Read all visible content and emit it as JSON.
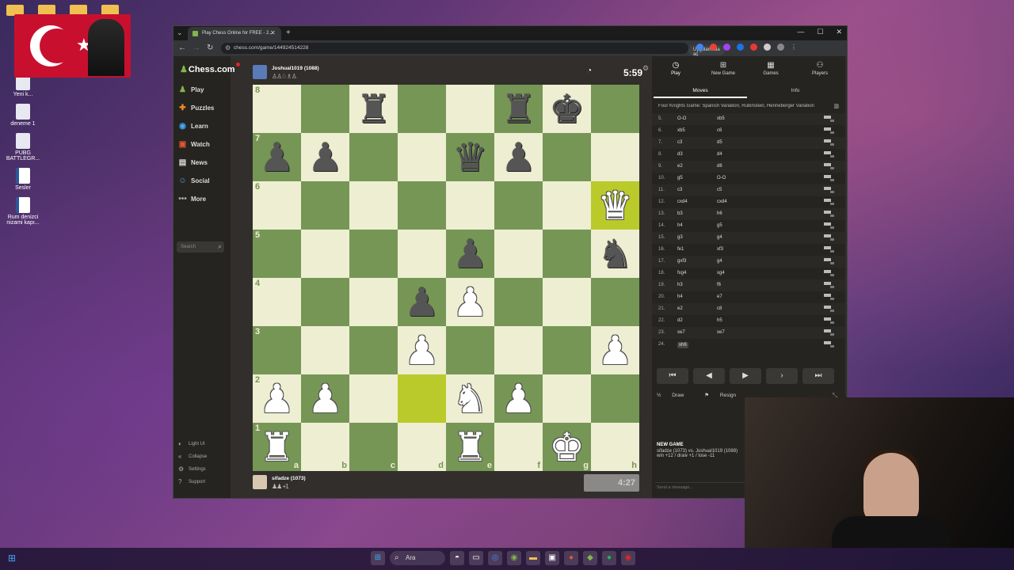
{
  "desktop": {
    "icons": [
      {
        "label": "Yeni k..."
      },
      {
        "label": "deneme 1"
      },
      {
        "label": "PUBG BATTLEGR..."
      },
      {
        "label": "Sesler"
      },
      {
        "label": "Rum denizci nizami kapı..."
      }
    ]
  },
  "browser": {
    "tab_title": "Play Chess Online for FREE - 2...",
    "url": "chess.com/game/144924514228",
    "app_pill": "Uygulamada aç"
  },
  "sidebar": {
    "logo": "Chess.com",
    "items": [
      {
        "label": "Play",
        "icon": "play-icon"
      },
      {
        "label": "Puzzles",
        "icon": "puzzle-icon"
      },
      {
        "label": "Learn",
        "icon": "learn-icon"
      },
      {
        "label": "Watch",
        "icon": "watch-icon"
      },
      {
        "label": "News",
        "icon": "news-icon"
      },
      {
        "label": "Social",
        "icon": "social-icon"
      },
      {
        "label": "More",
        "icon": "more-icon"
      }
    ],
    "search_placeholder": "Search",
    "bottom": [
      {
        "label": "Light UI"
      },
      {
        "label": "Collapse"
      },
      {
        "label": "Settings"
      },
      {
        "label": "Support"
      }
    ]
  },
  "game": {
    "top_player": {
      "name": "Joshual1019 (1088)",
      "captured": "♙♙♘♗♙",
      "clock": "5:59"
    },
    "bottom_player": {
      "name": "sifadze (1073)",
      "captured": "♟♟ +1",
      "clock": "4:27"
    },
    "board": [
      [
        "",
        "",
        "♜",
        "",
        "",
        "♜",
        "♚",
        ""
      ],
      [
        "♟",
        "♟",
        "",
        "",
        "♛",
        "♟",
        "",
        ""
      ],
      [
        "",
        "",
        "",
        "",
        "",
        "",
        "",
        "♕"
      ],
      [
        "",
        "",
        "",
        "",
        "♟",
        "",
        "",
        "♞"
      ],
      [
        "",
        "",
        "",
        "♟",
        "♙",
        "",
        "",
        ""
      ],
      [
        "",
        "",
        "",
        "♙",
        "",
        "",
        "",
        "♙"
      ],
      [
        "♙",
        "♙",
        "",
        "",
        "♘",
        "♙",
        "",
        ""
      ],
      [
        "♖",
        "",
        "",
        "",
        "♖",
        "",
        "♔",
        ""
      ]
    ],
    "white_pieces": [
      "♕",
      "♘",
      "♙",
      "♖",
      "♔"
    ],
    "highlight": [
      "d2",
      "h6"
    ],
    "ranks": [
      "8",
      "7",
      "6",
      "5",
      "4",
      "3",
      "2",
      "1"
    ],
    "files": [
      "a",
      "b",
      "c",
      "d",
      "e",
      "f",
      "g",
      "h"
    ]
  },
  "panel": {
    "nav": [
      {
        "label": "Play",
        "icon": "play-icon"
      },
      {
        "label": "New Game",
        "icon": "plus-icon"
      },
      {
        "label": "Games",
        "icon": "games-icon"
      },
      {
        "label": "Players",
        "icon": "players-icon"
      }
    ],
    "tabs": [
      "Moves",
      "Info"
    ],
    "opening": "Four Knights Game: Spanish Variation, Rubinstein, Henneberger Variation",
    "moves": [
      {
        "num": "5.",
        "white": "O-O",
        "black": "xb5"
      },
      {
        "num": "6.",
        "white": "xb5",
        "black": "c6"
      },
      {
        "num": "7.",
        "white": "c3",
        "black": "d5"
      },
      {
        "num": "8.",
        "white": "d3",
        "black": "d4"
      },
      {
        "num": "9.",
        "white": "e2",
        "black": "d6"
      },
      {
        "num": "10.",
        "white": "g5",
        "black": "O-O"
      },
      {
        "num": "11.",
        "white": "c3",
        "black": "c5"
      },
      {
        "num": "12.",
        "white": "cxd4",
        "black": "cxd4"
      },
      {
        "num": "13.",
        "white": "b3",
        "black": "h6"
      },
      {
        "num": "14.",
        "white": "h4",
        "black": "g5"
      },
      {
        "num": "15.",
        "white": "g3",
        "black": "g4"
      },
      {
        "num": "16.",
        "white": "fe1",
        "black": "xf3"
      },
      {
        "num": "17.",
        "white": "gxf3",
        "black": "g4"
      },
      {
        "num": "18.",
        "white": "fxg4",
        "black": "xg4"
      },
      {
        "num": "19.",
        "white": "h3",
        "black": "f6"
      },
      {
        "num": "20.",
        "white": "h4",
        "black": "e7"
      },
      {
        "num": "21.",
        "white": "e2",
        "black": "c8"
      },
      {
        "num": "22.",
        "white": "d2",
        "black": "h5"
      },
      {
        "num": "23.",
        "white": "xe7",
        "black": "xe7"
      },
      {
        "num": "24.",
        "white": "xh6",
        "black": ""
      }
    ],
    "controls": [
      "⏮",
      "◀",
      "▶",
      "▷",
      "⏭"
    ],
    "draw": "Draw",
    "resign": "Resign",
    "new_game_title": "NEW GAME",
    "new_game_players": "sifadze (1073) vs. Joshual1019 (1088)",
    "new_game_record": "win +12 / draw +1 / lose -11",
    "chat_placeholder": "Send a message..."
  },
  "taskbar": {
    "search": "Ara"
  }
}
